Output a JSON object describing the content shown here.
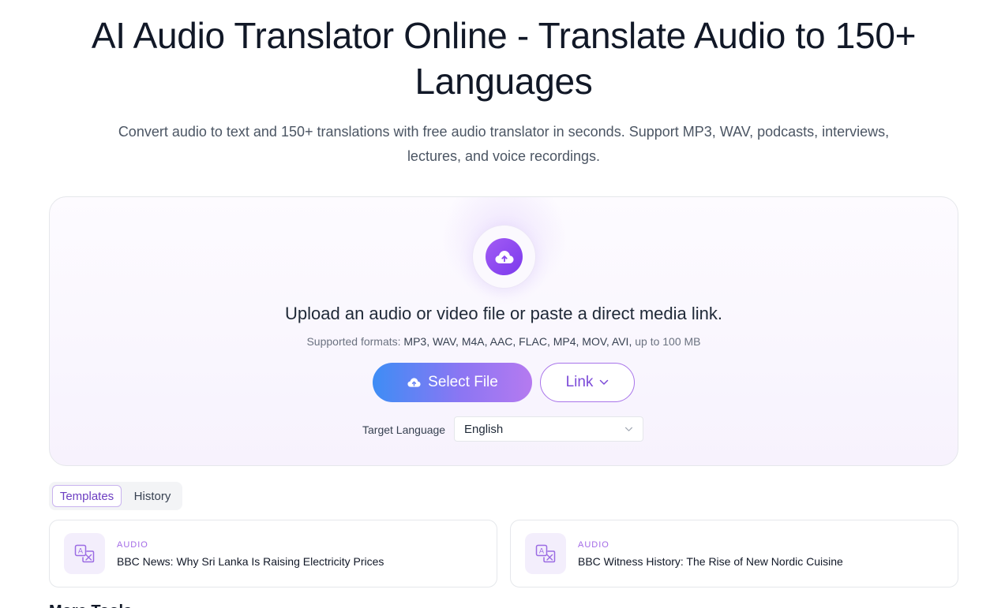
{
  "hero": {
    "title": "AI Audio Translator Online - Translate Audio to 150+ Languages",
    "subtitle": "Convert audio to text and 150+ translations with free audio translator in seconds. Support MP3, WAV, podcasts, interviews, lectures, and voice recordings."
  },
  "upload": {
    "heading": "Upload an audio or video file or paste a direct media link.",
    "formats_prefix": "Supported formats:",
    "formats_list": "MP3, WAV, M4A, AAC, FLAC, MP4, MOV, AVI,",
    "formats_suffix": "up to 100 MB",
    "select_file_label": "Select File",
    "link_label": "Link",
    "target_language_label": "Target Language",
    "target_language_value": "English"
  },
  "tabs": [
    {
      "label": "Templates",
      "active": true
    },
    {
      "label": "History",
      "active": false
    }
  ],
  "templates": [
    {
      "category": "AUDIO",
      "title": "BBC News: Why Sri Lanka Is Raising Electricity Prices"
    },
    {
      "category": "AUDIO",
      "title": "BBC Witness History: The Rise of New Nordic Cuisine"
    }
  ],
  "next_section_peek": "More Tools",
  "colors": {
    "accent_purple": "#7c3aed",
    "button_gradient_start": "#3e8df5",
    "button_gradient_end": "#b57af0",
    "link_border": "#a874ea"
  },
  "icons": {
    "upload": "cloud-upload-icon",
    "select_file": "cloud-upload-icon",
    "link_dropdown": "chevron-down-icon",
    "language_dropdown": "chevron-down-icon",
    "template": "translate-icon"
  }
}
